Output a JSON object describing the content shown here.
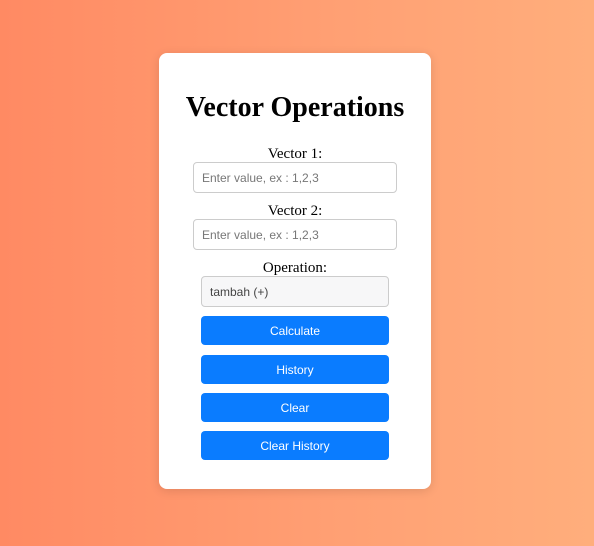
{
  "page": {
    "title": "Vector Operations"
  },
  "form": {
    "vector1_label": "Vector 1:",
    "vector1_placeholder": "Enter value, ex : 1,2,3",
    "vector1_value": "",
    "vector2_label": "Vector 2:",
    "vector2_placeholder": "Enter value, ex : 1,2,3",
    "vector2_value": "",
    "operation_label": "Operation:",
    "operation_selected": "tambah (+)"
  },
  "buttons": {
    "calculate": "Calculate",
    "history": "History",
    "clear": "Clear",
    "clear_history": "Clear History"
  },
  "colors": {
    "button_blue": "#0a7cff",
    "background_gradient_start": "#ff8a63",
    "background_gradient_end": "#ffae7c"
  }
}
